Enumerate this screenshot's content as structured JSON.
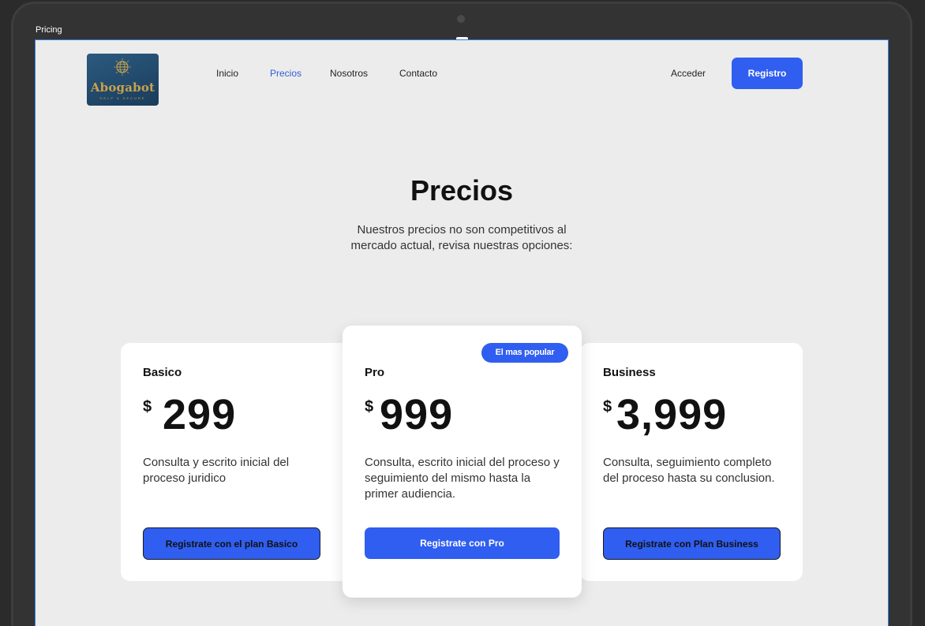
{
  "frame": {
    "label": "Pricing"
  },
  "logo": {
    "brand": "Abogabot",
    "tagline": "HELP & SECURE",
    "icon": "globe-icon"
  },
  "nav": {
    "links": [
      "Inicio",
      "Precios",
      "Nosotros",
      "Contacto"
    ],
    "active": "Precios",
    "login_label": "Acceder",
    "register_label": "Registro"
  },
  "hero": {
    "title": "Precios",
    "subtitle": "Nuestros precios no son competitivos al mercado actual, revisa nuestras opciones:"
  },
  "plans": [
    {
      "name": "Basico",
      "currency": "$",
      "price": "299",
      "description": "Consulta y escrito inicial del proceso juridico",
      "cta": "Registrate con el plan Basico"
    },
    {
      "name": "Pro",
      "currency": "$",
      "price": "999",
      "description": "Consulta, escrito inicial del proceso y seguimiento del mismo hasta la primer audiencia.",
      "cta": "Registrate con Pro",
      "badge": "El mas popular"
    },
    {
      "name": "Business",
      "currency": "$",
      "price": "3,999",
      "description": "Consulta, seguimiento completo del proceso hasta su conclusion.",
      "cta": "Registrate con Plan Business"
    }
  ],
  "colors": {
    "accent": "#2f5ef0",
    "background": "#ececec",
    "card": "#ffffff",
    "frame": "#333333"
  }
}
